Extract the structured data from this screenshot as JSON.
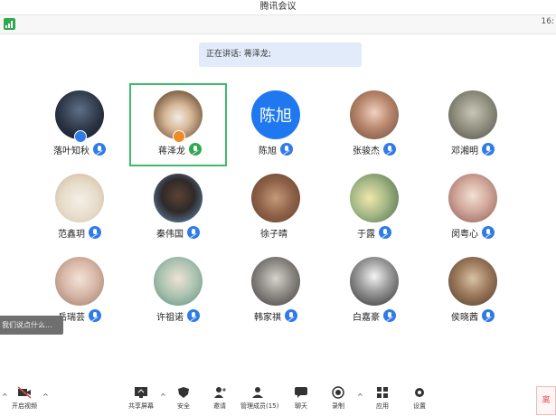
{
  "window": {
    "title": "腾讯会议"
  },
  "topbar": {
    "view_label": "16:"
  },
  "speaking": {
    "text": "正在讲话: 蒋泽龙;"
  },
  "participants": [
    {
      "name": "落叶知秋",
      "host": true
    },
    {
      "name": "蒋泽龙",
      "speaking": true
    },
    {
      "name": "陈旭",
      "avatar_text": "陈旭",
      "avatar_color": "#1f78f0"
    },
    {
      "name": "张骏杰"
    },
    {
      "name": "邓湘明"
    },
    {
      "name": "范鑫玥"
    },
    {
      "name": "秦伟国"
    },
    {
      "name": "徐子晴"
    },
    {
      "name": "于露"
    },
    {
      "name": "闵粤心"
    },
    {
      "name": "岳瑞芸"
    },
    {
      "name": "许祖诺"
    },
    {
      "name": "韩家祺"
    },
    {
      "name": "白嘉豪"
    },
    {
      "name": "侯晓茜"
    }
  ],
  "chat_preview": {
    "text": "我们说点什么..."
  },
  "toolbar": {
    "open_video": "开启视频",
    "share_screen": "共享屏幕",
    "security": "安全",
    "invite": "邀请",
    "manage_members": "管理成员(15)",
    "chat": "聊天",
    "record": "录制",
    "apps": "应用",
    "settings": "设置"
  },
  "corner": {
    "label": "离"
  },
  "colors": {
    "accent": "#2f7be8",
    "active_border": "#3fba6b",
    "speaking_banner": "#e1ebfa"
  }
}
